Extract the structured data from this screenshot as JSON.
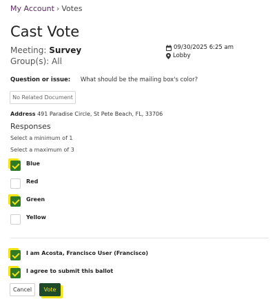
{
  "breadcrumb": {
    "parent": "My Account",
    "separator": "›",
    "current": "Votes"
  },
  "page": {
    "title": "Cast Vote"
  },
  "meeting": {
    "label": "Meeting:",
    "name": "Survey",
    "groups_label": "Group(s):",
    "groups_value": "All",
    "datetime": "09/30/2025 6:25 am",
    "location": "Lobby",
    "datetime_icon": "calendar-icon",
    "location_icon": "map-pin-icon"
  },
  "question": {
    "label": "Question or issue:",
    "text": "What should be the mailing box's color?"
  },
  "document_button": "No Related Document",
  "address": {
    "label": "Address",
    "value": "491 Paradise Circle, St Pete Beach, FL, 33706"
  },
  "responses": {
    "heading": "Responses",
    "min_text": "Select a minimum of 1",
    "max_text": "Select a maximum of 3",
    "options": [
      {
        "label": "Blue",
        "checked": true
      },
      {
        "label": "Red",
        "checked": false
      },
      {
        "label": "Green",
        "checked": true
      },
      {
        "label": "Yellow",
        "checked": false
      }
    ]
  },
  "confirmations": {
    "identity": {
      "label": "I am Acosta, Francisco User (Francisco)",
      "checked": true
    },
    "agree": {
      "label": "I agree to submit this ballot",
      "checked": true
    }
  },
  "actions": {
    "cancel": "Cancel",
    "vote": "Vote"
  },
  "colors": {
    "check_green": "#2f7a26",
    "highlight_yellow": "#f2e31a",
    "vote_button": "#1f4a2a",
    "breadcrumb_link": "#5a2a5f"
  }
}
